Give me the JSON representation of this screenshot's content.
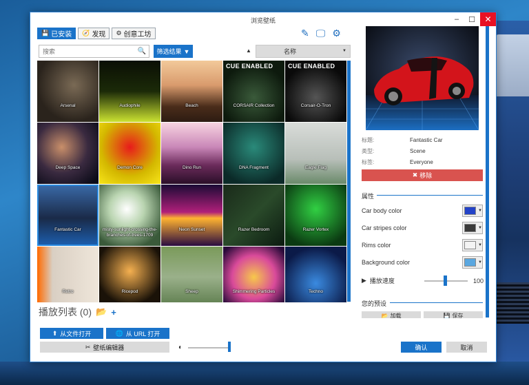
{
  "window": {
    "title": "浏览壁纸"
  },
  "tabs": [
    {
      "label": "已安装",
      "icon": "save-icon"
    },
    {
      "label": "发现",
      "icon": "compass-icon"
    },
    {
      "label": "创意工坊",
      "icon": "steam-icon"
    }
  ],
  "toolbar": {
    "icons": [
      "wrench-icon",
      "monitor-icon",
      "gear-icon"
    ]
  },
  "search": {
    "placeholder": "搜索"
  },
  "filter": {
    "label": "筛选结果"
  },
  "sort": {
    "label": "名称"
  },
  "wallpapers": [
    {
      "title": "Arsenal",
      "cue": ""
    },
    {
      "title": "Audiophile",
      "cue": ""
    },
    {
      "title": "Beach",
      "cue": ""
    },
    {
      "title": "CORSAIR Collection",
      "cue": "CUE ENABLED"
    },
    {
      "title": "Corsair-O-Tron",
      "cue": "CUE ENABLED"
    },
    {
      "title": "Deep Space",
      "cue": ""
    },
    {
      "title": "Demon Core",
      "cue": ""
    },
    {
      "title": "Dino Run",
      "cue": ""
    },
    {
      "title": "DNA Fragment",
      "cue": ""
    },
    {
      "title": "Eagle Flag",
      "cue": ""
    },
    {
      "title": "Fantastic Car",
      "cue": ""
    },
    {
      "title": "misty-sunlight-crossing-the-branches-of-trees-1709",
      "cue": ""
    },
    {
      "title": "Neon Sunset",
      "cue": ""
    },
    {
      "title": "Razer Bedroom",
      "cue": ""
    },
    {
      "title": "Razer Vortex",
      "cue": ""
    },
    {
      "title": "Retro",
      "cue": ""
    },
    {
      "title": "Ricepod",
      "cue": ""
    },
    {
      "title": "Sheep",
      "cue": ""
    },
    {
      "title": "Shimmering Particles",
      "cue": ""
    },
    {
      "title": "Techno",
      "cue": ""
    }
  ],
  "playlist": {
    "label": "播放列表 (0)"
  },
  "bottom": {
    "open_file": "从文件打开",
    "open_url": "从 URL 打开",
    "editor": "壁纸编辑器",
    "volume": 0.95
  },
  "details": {
    "rows": [
      {
        "key": "标题:",
        "value": "Fantastic Car"
      },
      {
        "key": "类型:",
        "value": "Scene"
      },
      {
        "key": "标签:",
        "value": "Everyone"
      }
    ],
    "remove_label": "移除"
  },
  "properties": {
    "title": "属性",
    "items": [
      {
        "label": "Car body color",
        "color": "#2343c8"
      },
      {
        "label": "Car stripes color",
        "color": "#3a3a3a"
      },
      {
        "label": "Rims color",
        "color": "#f4f4f4"
      },
      {
        "label": "Background color",
        "color": "#5aa7e0"
      }
    ],
    "speed_label": "播放速度",
    "speed_value": "100"
  },
  "presets": {
    "title": "您的预设",
    "load": "加载",
    "save": "保存"
  },
  "dialog": {
    "ok": "确认",
    "cancel": "取消"
  }
}
